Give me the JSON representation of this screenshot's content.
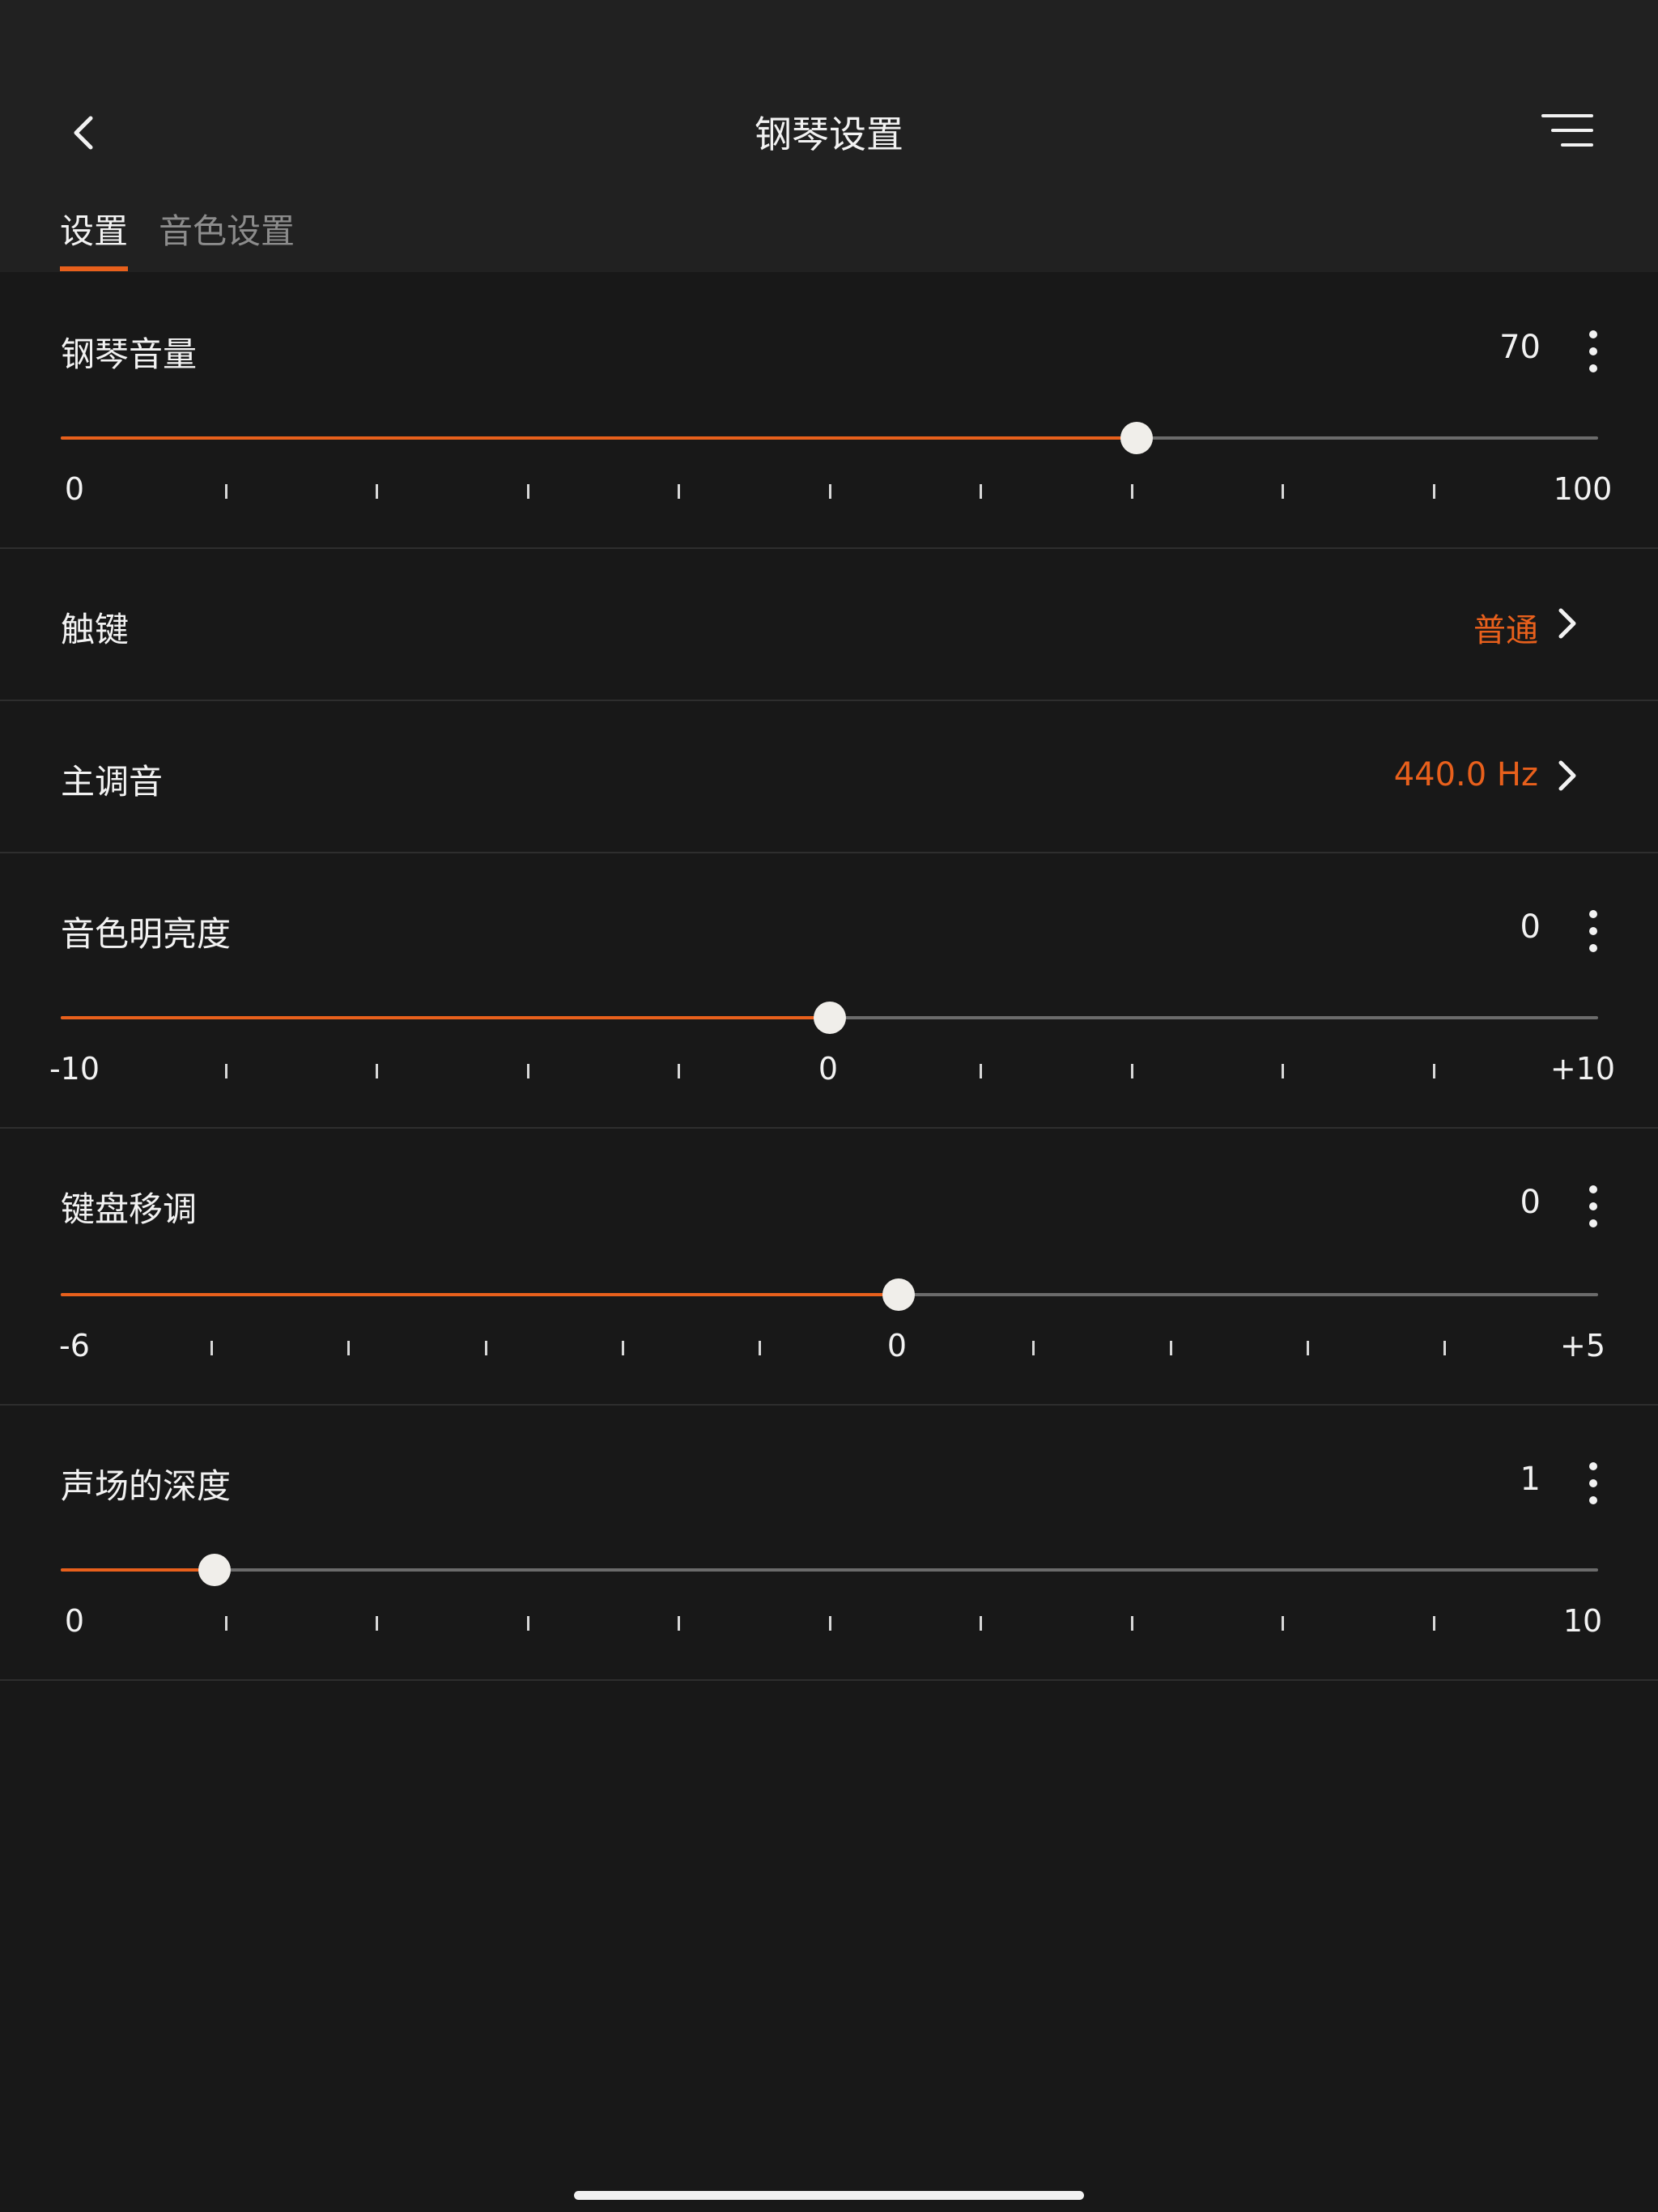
{
  "header": {
    "title": "钢琴设置",
    "back_icon": "chevron-left-icon",
    "menu_icon": "hamburger-menu-icon"
  },
  "tabs": [
    {
      "label": "设置",
      "active": true
    },
    {
      "label": "音色设置",
      "active": false
    }
  ],
  "colors": {
    "accent": "#e8601c",
    "background": "#181818",
    "header_background": "#212121",
    "text": "#f2f2f2",
    "muted_text": "#8c8c8c",
    "track": "#6b6b6b"
  },
  "settings": {
    "piano_volume": {
      "label": "钢琴音量",
      "value": "70",
      "min_label": "0",
      "max_label": "100",
      "fraction": 0.7
    },
    "touch": {
      "label": "触键",
      "value": "普通"
    },
    "master_tuning": {
      "label": "主调音",
      "value": "440.0 Hz"
    },
    "brightness": {
      "label": "音色明亮度",
      "value": "0",
      "min_label": "-10",
      "mid_label": "0",
      "max_label": "+10",
      "fraction": 0.5
    },
    "transpose": {
      "label": "键盘移调",
      "value": "0",
      "min_label": "-6",
      "mid_label": "0",
      "max_label": "+5",
      "fraction": 0.545
    },
    "depth": {
      "label": "声场的深度",
      "value": "1",
      "min_label": "0",
      "max_label": "10",
      "fraction": 0.1
    }
  }
}
